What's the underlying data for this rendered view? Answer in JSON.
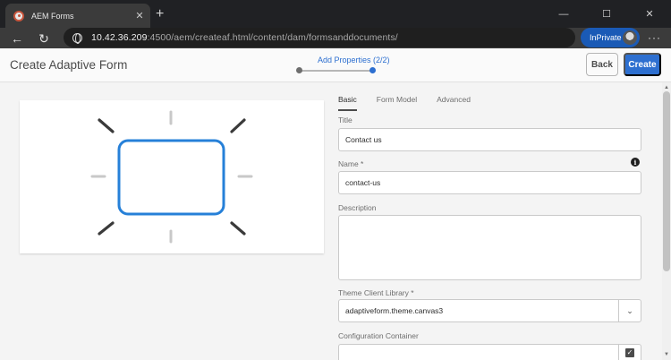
{
  "browser": {
    "tab_title": "AEM Forms",
    "tab_close": "✕",
    "new_tab": "+",
    "url_host": "10.42.36.209",
    "url_rest": ":4500/aem/createaf.html/content/dam/formsanddocuments/",
    "inprivate_label": "InPrivate",
    "menu": "···",
    "back": "←",
    "refresh": "↻",
    "minimize": "—",
    "maximize": "☐",
    "close": "✕"
  },
  "header": {
    "title": "Create Adaptive Form",
    "wizard_step": "Add Properties (2/2)",
    "back_label": "Back",
    "create_label": "Create"
  },
  "properties": {
    "tabs": [
      "Basic",
      "Form Model",
      "Advanced"
    ],
    "active_tab": "Basic",
    "title_label": "Title",
    "title_value": "Contact us",
    "name_label": "Name *",
    "name_value": "contact-us",
    "description_label": "Description",
    "description_value": "",
    "theme_label": "Theme Client Library *",
    "theme_value": "adaptiveform.theme.canvas3",
    "config_label": "Configuration Container",
    "config_value": ""
  },
  "colors": {
    "accent": "#2d6fd0",
    "preview_frame": "#2680d8"
  }
}
